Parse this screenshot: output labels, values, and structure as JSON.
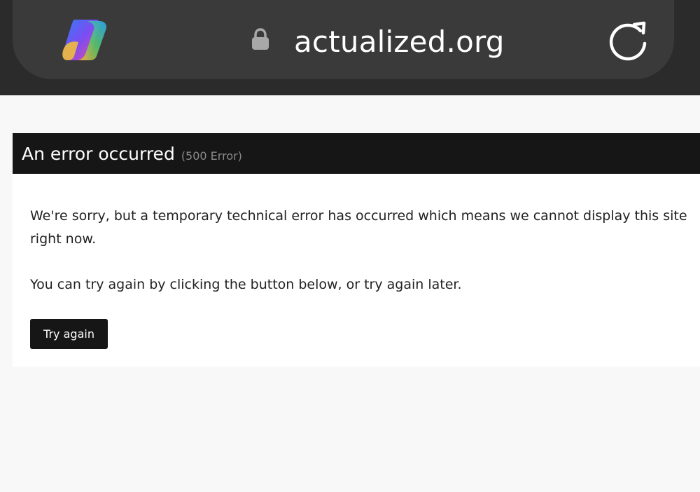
{
  "browser": {
    "url": "actualized.org",
    "app_icon": "copilot-logo",
    "lock_icon": "lock-icon",
    "reload_icon": "reload-icon"
  },
  "error": {
    "title": "An error occurred",
    "code": "(500 Error)",
    "message": "We're sorry, but a temporary technical error has occurred which means we cannot display this site right now.",
    "retry_message": "You can try again by clicking the button below, or try again later.",
    "button_label": "Try again"
  },
  "colors": {
    "browser_bar": "#2b2b2b",
    "url_pill": "#3a3a3a",
    "error_header": "#161616",
    "button": "#161616",
    "page_background": "#f8f8f8"
  }
}
